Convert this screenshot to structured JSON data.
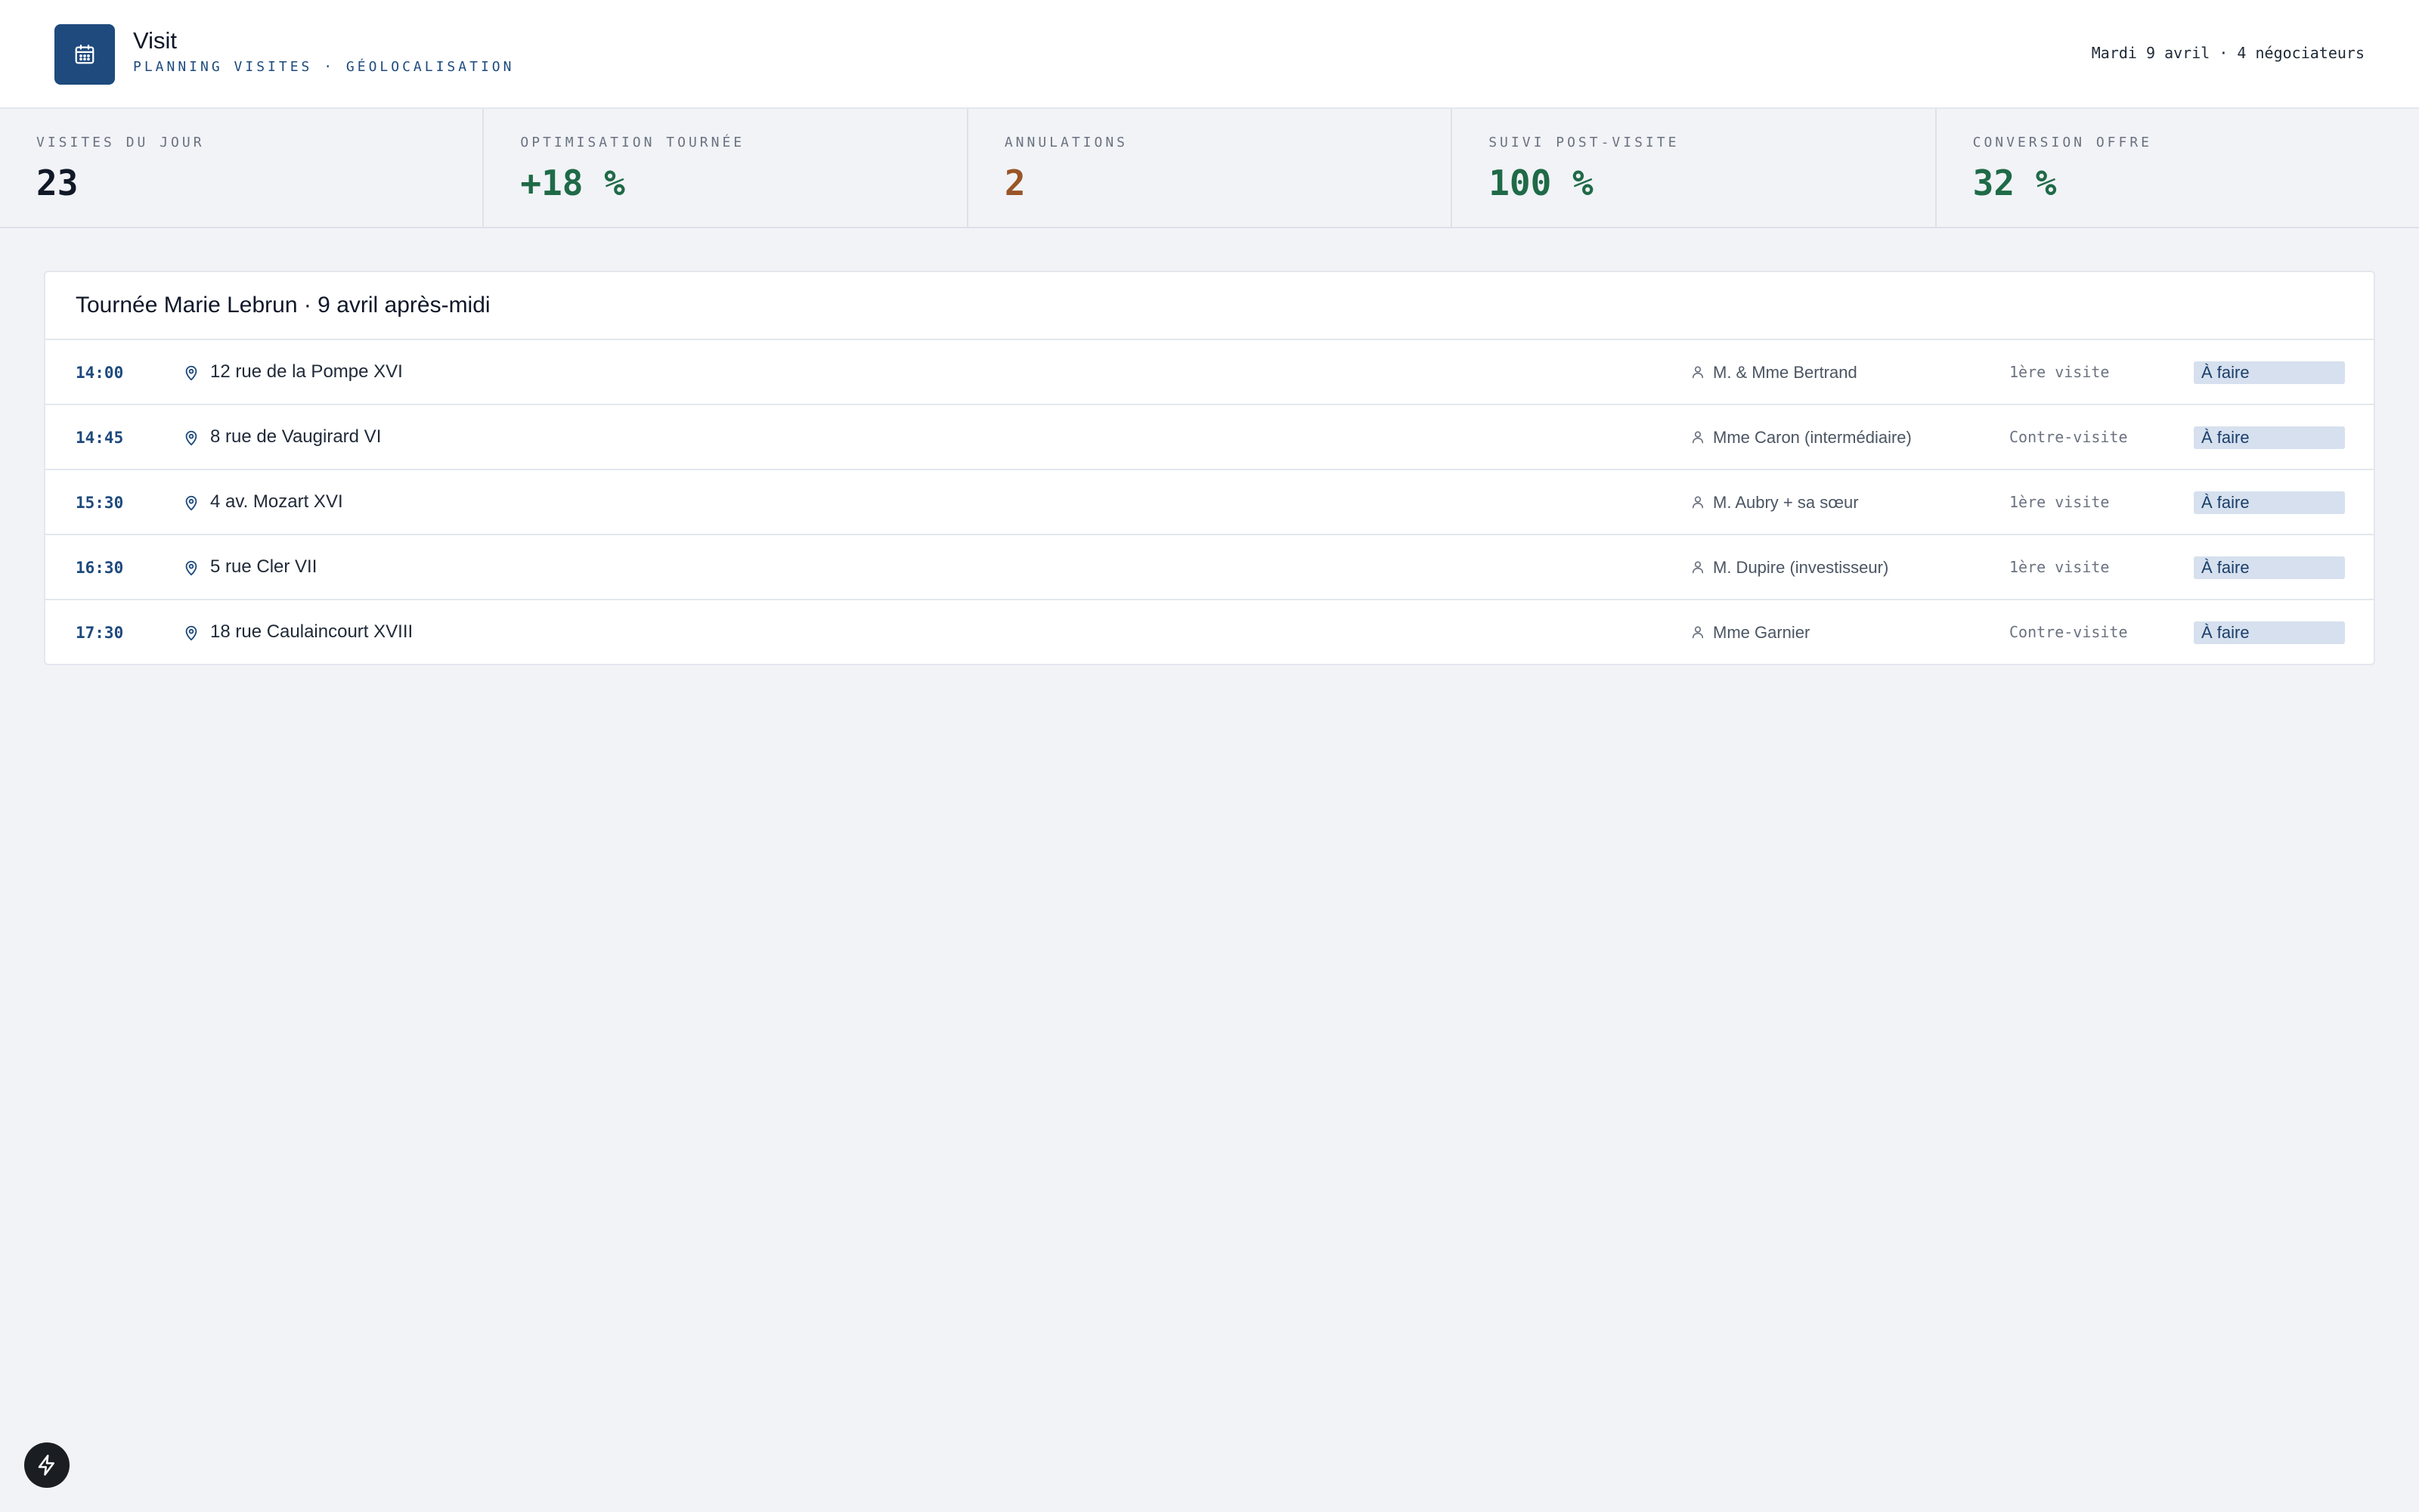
{
  "app": {
    "title": "Visit",
    "subtitle": "PLANNING VISITES · GÉOLOCALISATION",
    "logo_icon": "calendar-icon",
    "meta": "Mardi 9 avril · 4 négociateurs",
    "brand_color": "#1e4a7d"
  },
  "kpis": [
    {
      "label": "VISITES DU JOUR",
      "value": "23",
      "color": "#111827"
    },
    {
      "label": "OPTIMISATION TOURNÉE",
      "value": "+18 %",
      "color": "#1f6a47"
    },
    {
      "label": "ANNULATIONS",
      "value": "2",
      "color": "#9a5527"
    },
    {
      "label": "SUIVI POST-VISITE",
      "value": "100 %",
      "color": "#1f6a47"
    },
    {
      "label": "CONVERSION OFFRE",
      "value": "32 %",
      "color": "#1f6a47"
    }
  ],
  "tour": {
    "title": "Tournée Marie Lebrun · 9 avril après-midi",
    "rows": [
      {
        "time": "14:00",
        "address": "12 rue de la Pompe XVI",
        "contact": "M. & Mme Bertrand",
        "type": "1ère visite",
        "status": "À faire"
      },
      {
        "time": "14:45",
        "address": "8 rue de Vaugirard VI",
        "contact": "Mme Caron (intermédiaire)",
        "type": "Contre-visite",
        "status": "À faire"
      },
      {
        "time": "15:30",
        "address": "4 av. Mozart XVI",
        "contact": "M. Aubry + sa sœur",
        "type": "1ère visite",
        "status": "À faire"
      },
      {
        "time": "16:30",
        "address": "5 rue Cler VII",
        "contact": "M. Dupire (investisseur)",
        "type": "1ère visite",
        "status": "À faire"
      },
      {
        "time": "17:30",
        "address": "18 rue Caulaincourt XVIII",
        "contact": "Mme Garnier",
        "type": "Contre-visite",
        "status": "À faire"
      }
    ]
  },
  "floating_button": {
    "icon": "bolt-icon"
  }
}
